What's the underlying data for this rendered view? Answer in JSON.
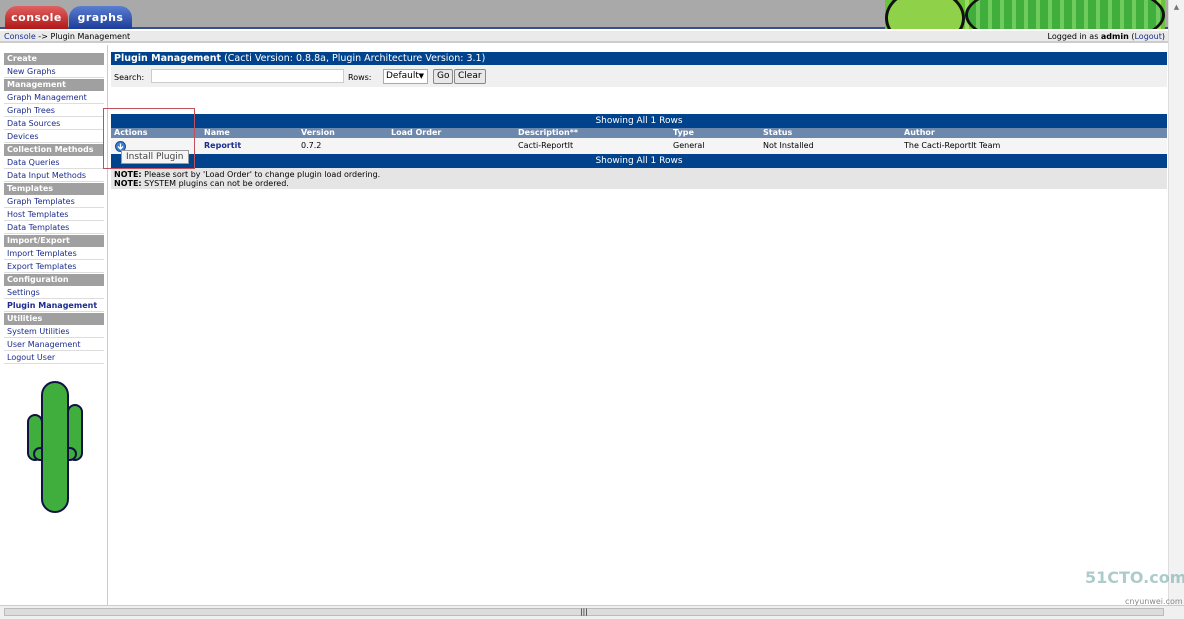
{
  "tabs": [
    {
      "label": "console"
    },
    {
      "label": "graphs"
    }
  ],
  "breadcrumb": {
    "root": "Console",
    "sep": " -> ",
    "current": "Plugin Management"
  },
  "login": {
    "prefix": "Logged in as ",
    "user": "admin",
    "logout": "Logout"
  },
  "sidebar": [
    {
      "type": "header",
      "label": "Create"
    },
    {
      "type": "item",
      "label": "New Graphs"
    },
    {
      "type": "header",
      "label": "Management"
    },
    {
      "type": "item",
      "label": "Graph Management"
    },
    {
      "type": "item",
      "label": "Graph Trees"
    },
    {
      "type": "item",
      "label": "Data Sources"
    },
    {
      "type": "item",
      "label": "Devices"
    },
    {
      "type": "header",
      "label": "Collection Methods"
    },
    {
      "type": "item",
      "label": "Data Queries"
    },
    {
      "type": "item",
      "label": "Data Input Methods"
    },
    {
      "type": "header",
      "label": "Templates"
    },
    {
      "type": "item",
      "label": "Graph Templates"
    },
    {
      "type": "item",
      "label": "Host Templates"
    },
    {
      "type": "item",
      "label": "Data Templates"
    },
    {
      "type": "header",
      "label": "Import/Export"
    },
    {
      "type": "item",
      "label": "Import Templates"
    },
    {
      "type": "item",
      "label": "Export Templates"
    },
    {
      "type": "header",
      "label": "Configuration"
    },
    {
      "type": "item",
      "label": "Settings"
    },
    {
      "type": "item",
      "label": "Plugin Management",
      "selected": true
    },
    {
      "type": "header",
      "label": "Utilities"
    },
    {
      "type": "item",
      "label": "System Utilities"
    },
    {
      "type": "item",
      "label": "User Management"
    },
    {
      "type": "item",
      "label": "Logout User"
    }
  ],
  "main": {
    "title": "Plugin Management",
    "subtitle": " (Cacti Version: 0.8.8a, Plugin Architecture Version: 3.1)",
    "search_label": "Search:",
    "search_value": "",
    "rows_label": "Rows:",
    "rows_value": "Default",
    "go": "Go",
    "clear": "Clear",
    "showing": "Showing All 1 Rows",
    "columns": [
      "Actions",
      "Name",
      "Version",
      "Load Order",
      "Description**",
      "Type",
      "Status",
      "Author"
    ],
    "rows": [
      {
        "name": "Reportit",
        "version": "0.7.2",
        "load_order": "",
        "description": "Cacti-ReportIt",
        "type": "General",
        "status": "Not Installed",
        "author": "The Cacti-ReportIt Team"
      }
    ],
    "notes": [
      {
        "label": "NOTE:",
        "text": " Please sort by 'Load Order' to change plugin load ordering."
      },
      {
        "label": "NOTE:",
        "text": " SYSTEM plugins can not be ordered."
      }
    ],
    "tooltip": "Install Plugin"
  },
  "watermark": {
    "line1": "51CTO.com",
    "line2": "cnyunwei.com"
  },
  "colors": {
    "header": "#00438c",
    "table_head": "#6d88ad",
    "nav_header": "#a0a0a0",
    "link": "#1c2c8c"
  }
}
